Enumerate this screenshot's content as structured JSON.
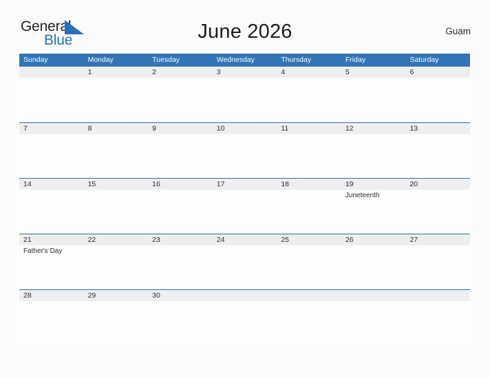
{
  "brand": {
    "name_part1": "General",
    "name_part2": "Blue",
    "flag_icon": "flag-triangle-icon",
    "color_dark": "#231f20",
    "color_blue": "#2572b8"
  },
  "header": {
    "title": "June 2026",
    "region": "Guam"
  },
  "calendar": {
    "header_bg": "#3175b6",
    "row_band_bg": "#efefef",
    "row_border": "#2a6ba8",
    "day_headers": [
      "Sunday",
      "Monday",
      "Tuesday",
      "Wednesday",
      "Thursday",
      "Friday",
      "Saturday"
    ],
    "weeks": [
      [
        {
          "date": "",
          "events": []
        },
        {
          "date": "1",
          "events": []
        },
        {
          "date": "2",
          "events": []
        },
        {
          "date": "3",
          "events": []
        },
        {
          "date": "4",
          "events": []
        },
        {
          "date": "5",
          "events": []
        },
        {
          "date": "6",
          "events": []
        }
      ],
      [
        {
          "date": "7",
          "events": []
        },
        {
          "date": "8",
          "events": []
        },
        {
          "date": "9",
          "events": []
        },
        {
          "date": "10",
          "events": []
        },
        {
          "date": "11",
          "events": []
        },
        {
          "date": "12",
          "events": []
        },
        {
          "date": "13",
          "events": []
        }
      ],
      [
        {
          "date": "14",
          "events": []
        },
        {
          "date": "15",
          "events": []
        },
        {
          "date": "16",
          "events": []
        },
        {
          "date": "17",
          "events": []
        },
        {
          "date": "18",
          "events": []
        },
        {
          "date": "19",
          "events": [
            "Juneteenth"
          ]
        },
        {
          "date": "20",
          "events": []
        }
      ],
      [
        {
          "date": "21",
          "events": [
            "Father's Day"
          ]
        },
        {
          "date": "22",
          "events": []
        },
        {
          "date": "23",
          "events": []
        },
        {
          "date": "24",
          "events": []
        },
        {
          "date": "25",
          "events": []
        },
        {
          "date": "26",
          "events": []
        },
        {
          "date": "27",
          "events": []
        }
      ],
      [
        {
          "date": "28",
          "events": []
        },
        {
          "date": "29",
          "events": []
        },
        {
          "date": "30",
          "events": []
        },
        {
          "date": "",
          "events": []
        },
        {
          "date": "",
          "events": []
        },
        {
          "date": "",
          "events": []
        },
        {
          "date": "",
          "events": []
        }
      ]
    ]
  }
}
